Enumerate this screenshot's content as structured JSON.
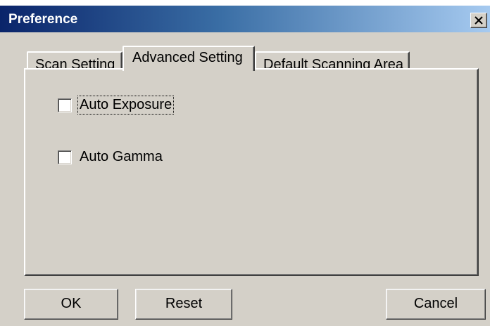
{
  "window": {
    "title": "Preference",
    "close_icon": "close-icon"
  },
  "tabs": [
    {
      "label": "Scan Setting",
      "active": false
    },
    {
      "label": "Advanced Setting",
      "active": true
    },
    {
      "label": "Default Scanning Area",
      "active": false
    }
  ],
  "options": {
    "auto_exposure": {
      "label": "Auto Exposure",
      "checked": false,
      "focused": true
    },
    "auto_gamma": {
      "label": "Auto Gamma",
      "checked": false,
      "focused": false
    }
  },
  "buttons": {
    "ok": "OK",
    "reset": "Reset",
    "cancel": "Cancel"
  },
  "colors": {
    "face": "#d4d0c8",
    "title_start": "#0a246a",
    "title_end": "#a6caf0"
  }
}
